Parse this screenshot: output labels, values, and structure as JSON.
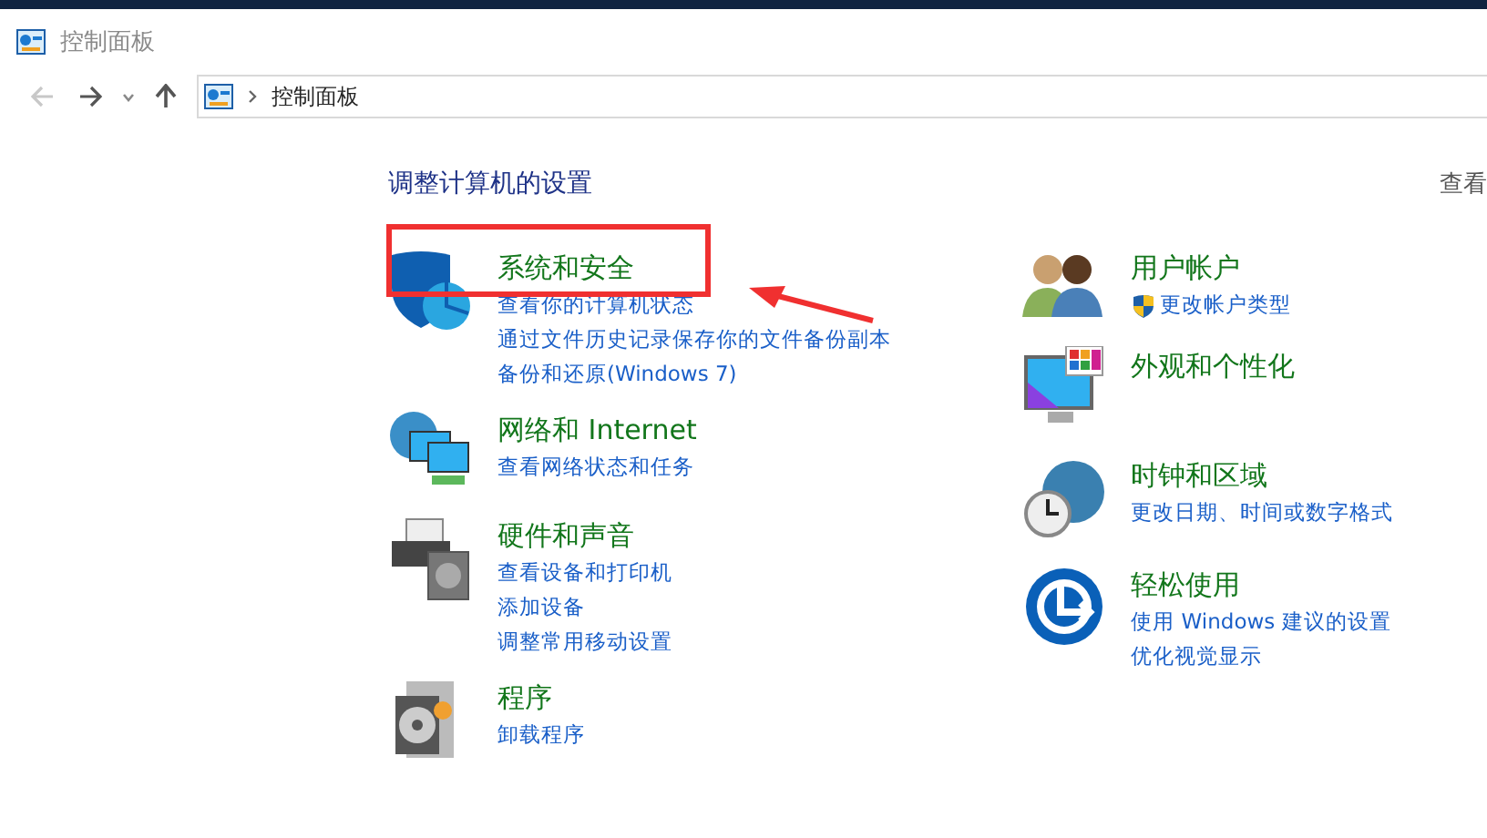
{
  "window": {
    "title": "控制面板"
  },
  "nav": {
    "back_disabled": true,
    "address": "控制面板"
  },
  "heading": "调整计算机的设置",
  "view_by": "查看",
  "columns": [
    [
      {
        "kind": "shield",
        "title": "系统和安全",
        "highlighted": true,
        "links": [
          {
            "text": "查看你的计算机状态",
            "shield": false
          },
          {
            "text": "通过文件历史记录保存你的文件备份副本",
            "shield": false
          },
          {
            "text": "备份和还原(Windows 7)",
            "shield": false
          }
        ]
      },
      {
        "kind": "network",
        "title": "网络和 Internet",
        "highlighted": false,
        "links": [
          {
            "text": "查看网络状态和任务",
            "shield": false
          }
        ]
      },
      {
        "kind": "printer",
        "title": "硬件和声音",
        "highlighted": false,
        "links": [
          {
            "text": "查看设备和打印机",
            "shield": false
          },
          {
            "text": "添加设备",
            "shield": false
          },
          {
            "text": "调整常用移动设置",
            "shield": false
          }
        ]
      },
      {
        "kind": "programs",
        "title": "程序",
        "highlighted": false,
        "links": [
          {
            "text": "卸载程序",
            "shield": false
          }
        ]
      }
    ],
    [
      {
        "kind": "users",
        "title": "用户帐户",
        "highlighted": false,
        "links": [
          {
            "text": "更改帐户类型",
            "shield": true
          }
        ]
      },
      {
        "kind": "monitor",
        "title": "外观和个性化",
        "highlighted": false
      },
      {
        "kind": "clock",
        "title": "时钟和区域",
        "highlighted": false,
        "links": [
          {
            "text": "更改日期、时间或数字格式",
            "shield": false
          }
        ]
      },
      {
        "kind": "ease",
        "title": "轻松使用",
        "highlighted": false,
        "links": [
          {
            "text": "使用 Windows 建议的设置",
            "shield": false
          },
          {
            "text": "优化视觉显示",
            "shield": false
          }
        ]
      }
    ]
  ]
}
